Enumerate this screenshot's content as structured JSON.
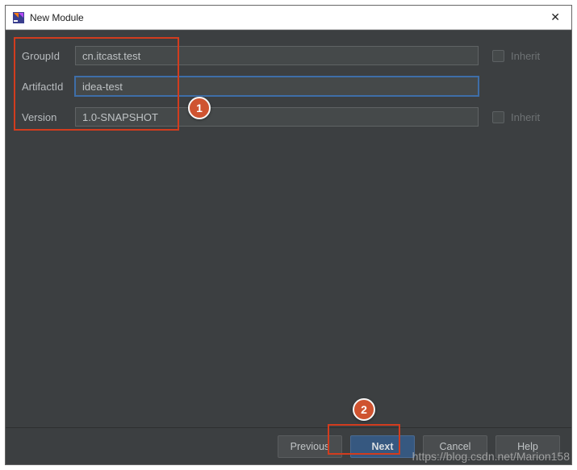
{
  "window": {
    "title": "New Module",
    "close_glyph": "✕"
  },
  "form": {
    "group_label": "GroupId",
    "group_value": "cn.itcast.test",
    "artifact_label": "ArtifactId",
    "artifact_value": "idea-test",
    "version_label": "Version",
    "version_value": "1.0-SNAPSHOT",
    "inherit_label": "Inherit"
  },
  "buttons": {
    "previous": "Previous",
    "next": "Next",
    "cancel": "Cancel",
    "help": "Help"
  },
  "annotations": {
    "callout1": "1",
    "callout2": "2"
  },
  "watermark": "https://blog.csdn.net/Marion158"
}
